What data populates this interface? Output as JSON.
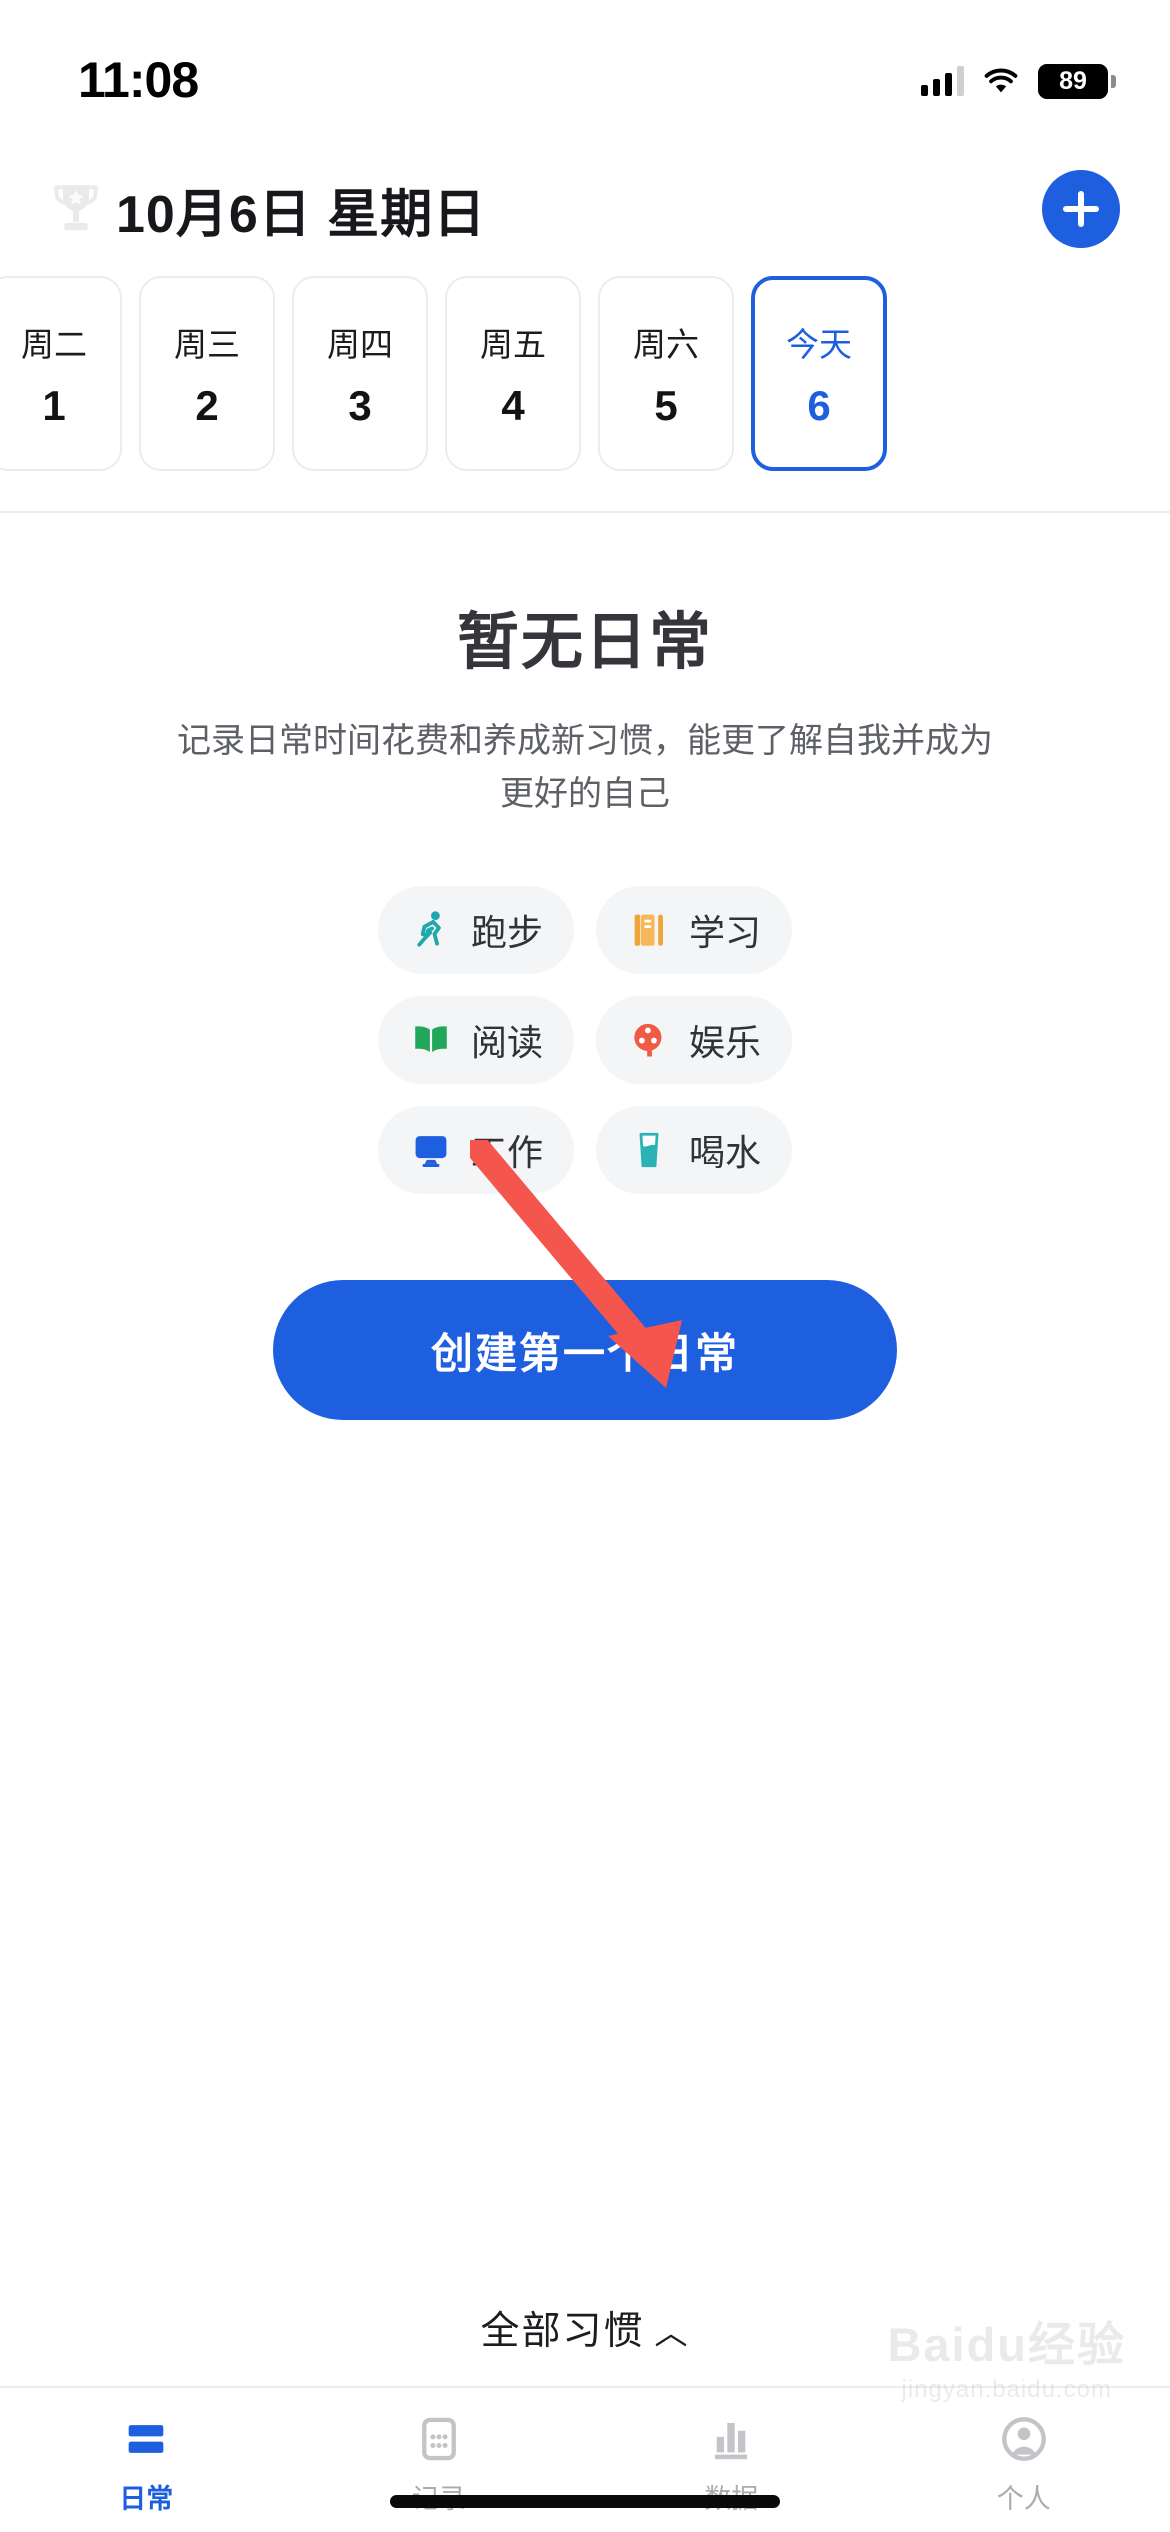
{
  "status_bar": {
    "time": "11:08",
    "battery_percent": "89",
    "signal_icon": "cellular-bars-icon",
    "wifi_icon": "wifi-icon",
    "battery_icon": "battery-icon"
  },
  "header": {
    "trophy_icon": "trophy-icon",
    "title": "10月6日 星期日",
    "add_label": "+"
  },
  "date_strip": {
    "days": [
      {
        "dow": "周二",
        "num": "1",
        "today": false
      },
      {
        "dow": "周三",
        "num": "2",
        "today": false
      },
      {
        "dow": "周四",
        "num": "3",
        "today": false
      },
      {
        "dow": "周五",
        "num": "4",
        "today": false
      },
      {
        "dow": "周六",
        "num": "5",
        "today": false
      },
      {
        "dow": "今天",
        "num": "6",
        "today": true
      }
    ]
  },
  "empty_state": {
    "title": "暂无日常",
    "subtitle": "记录日常时间花费和养成新习惯，能更了解自我并成为更好的自己",
    "suggestions": [
      {
        "label": "跑步",
        "icon": "running-icon",
        "color": "#20a8ac"
      },
      {
        "label": "学习",
        "icon": "book-study-icon",
        "color": "#f5a githubNone"
      },
      {
        "label": "阅读",
        "icon": "open-book-icon",
        "color": "#22a85a"
      },
      {
        "label": "娱乐",
        "icon": "film-reel-icon",
        "color": "#ef5b45"
      },
      {
        "label": "工作",
        "icon": "monitor-icon",
        "color": "#1e5fe0"
      },
      {
        "label": "喝水",
        "icon": "water-glass-icon",
        "color": "#2bb3b3"
      }
    ],
    "cta_label": "创建第一个日常"
  },
  "all_habits": {
    "label": "全部习惯",
    "caret_icon": "chevron-up-icon",
    "caret_glyph": "︿"
  },
  "tabbar": {
    "tabs": [
      {
        "label": "日常",
        "icon": "rows-icon",
        "active": true
      },
      {
        "label": "记录",
        "icon": "calendar-icon",
        "active": false
      },
      {
        "label": "数据",
        "icon": "bar-chart-icon",
        "active": false
      },
      {
        "label": "个人",
        "icon": "person-icon",
        "active": false
      }
    ]
  },
  "watermark": {
    "main": "Baidu经验",
    "sub": "jingyan.baidu.com"
  },
  "colors": {
    "accent": "#1e5fe0",
    "arrow": "#f4554c",
    "chip_bg": "#f4f5f6",
    "muted_text": "#a9abb0"
  }
}
